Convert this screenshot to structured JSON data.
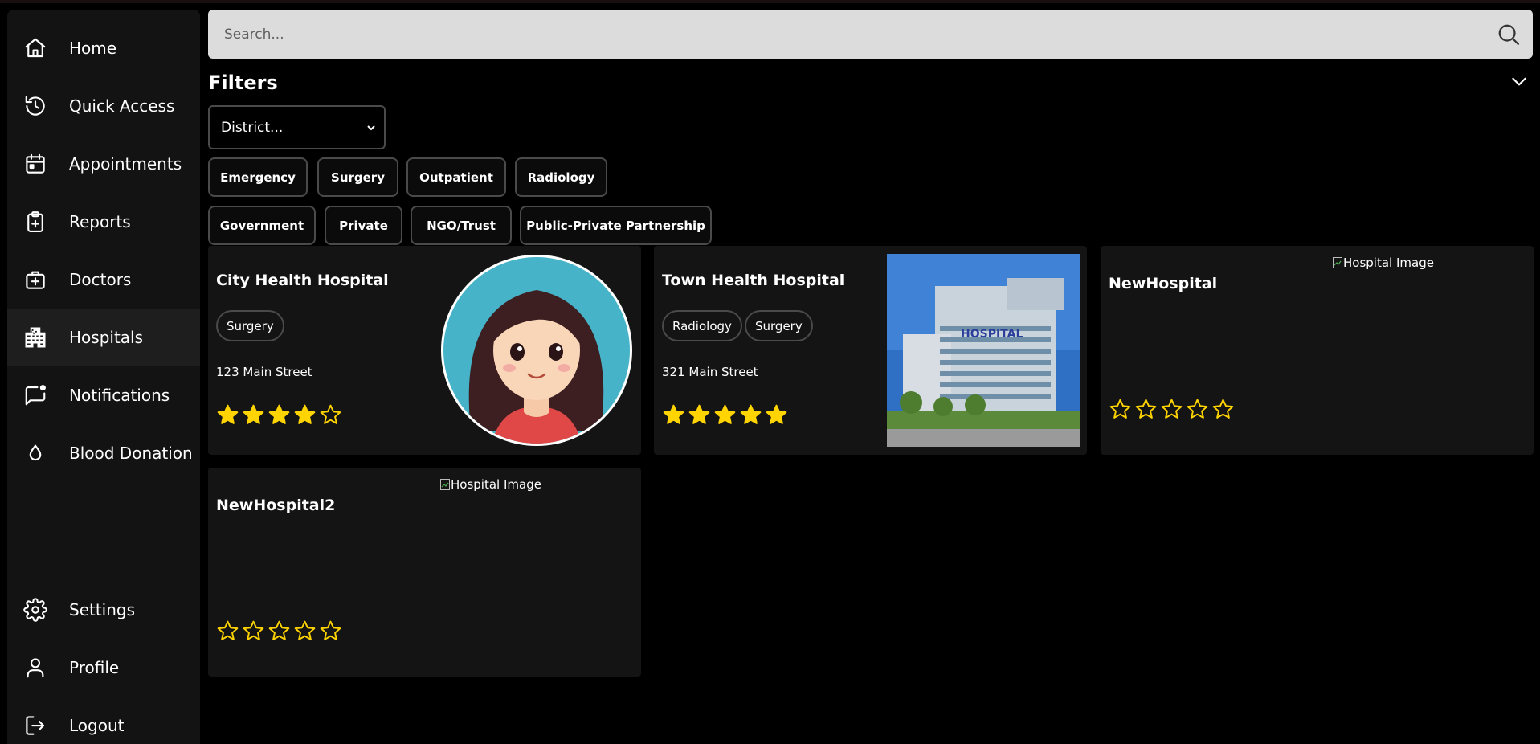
{
  "sidebar": {
    "items": [
      {
        "label": "Home",
        "icon": "home-icon"
      },
      {
        "label": "Quick Access",
        "icon": "history-icon"
      },
      {
        "label": "Appointments",
        "icon": "calendar-icon"
      },
      {
        "label": "Reports",
        "icon": "clipboard-plus-icon"
      },
      {
        "label": "Doctors",
        "icon": "medical-kit-icon"
      },
      {
        "label": "Hospitals",
        "icon": "hospital-icon",
        "active": true
      },
      {
        "label": "Notifications",
        "icon": "message-dot-icon"
      },
      {
        "label": "Blood Donation",
        "icon": "drop-icon"
      }
    ],
    "bottom_items": [
      {
        "label": "Settings",
        "icon": "gear-icon"
      },
      {
        "label": "Profile",
        "icon": "user-icon"
      },
      {
        "label": "Logout",
        "icon": "logout-icon"
      }
    ]
  },
  "search": {
    "placeholder": "Search...",
    "value": ""
  },
  "filters": {
    "title": "Filters",
    "district_select": {
      "selected": "District..."
    },
    "specialty_chips": [
      "Emergency",
      "Surgery",
      "Outpatient",
      "Radiology"
    ],
    "type_chips": [
      "Government",
      "Private",
      "NGO/Trust",
      "Public-Private Partnership"
    ]
  },
  "hospitals": [
    {
      "name": "City Health Hospital",
      "tags": [
        "Surgery"
      ],
      "address": "123 Main Street",
      "rating": 4,
      "max_rating": 5,
      "image": "cartoon-woman-avatar"
    },
    {
      "name": "Town Health Hospital",
      "tags": [
        "Radiology",
        "Surgery"
      ],
      "address": "321 Main Street",
      "rating": 5,
      "max_rating": 5,
      "image": "hospital-building-photo"
    },
    {
      "name": "NewHospital",
      "tags": [],
      "address": "",
      "rating": 0,
      "max_rating": 5,
      "image_alt": "Hospital Image"
    },
    {
      "name": "NewHospital2",
      "tags": [],
      "address": "",
      "rating": 0,
      "max_rating": 5,
      "image_alt": "Hospital Image"
    }
  ],
  "colors": {
    "background": "#000000",
    "sidebar": "#131313",
    "card": "#141414",
    "star": "#ffd400",
    "search_bg": "#dcdcdc"
  }
}
